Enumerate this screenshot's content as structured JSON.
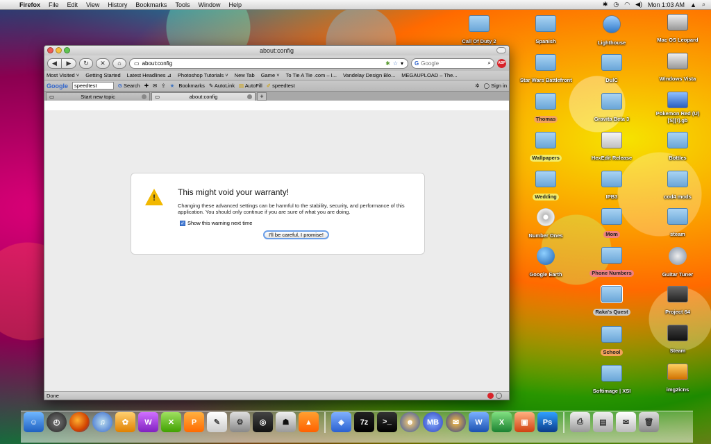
{
  "menubar": {
    "apple": "",
    "items": [
      "Firefox",
      "File",
      "Edit",
      "View",
      "History",
      "Bookmarks",
      "Tools",
      "Window",
      "Help"
    ],
    "clock": "Mon 1:03 AM"
  },
  "window": {
    "title": "about:config",
    "url": "about:config",
    "search_placeholder": "Google",
    "bookmarks": [
      "Most Visited ˅",
      "Getting Started",
      "Latest Headlines ⊿",
      "Photoshop Tutorials ˅",
      "New Tab",
      "Game ˅",
      "To Tie A Tie .com – I...",
      "Vandelay Design Blo...",
      "MEGAUPLOAD – The..."
    ],
    "googlebar": {
      "logo": "Google",
      "query": "speedtest",
      "search_label": "Search",
      "bookmarks_label": "Bookmarks",
      "autolink_label": "AutoLink",
      "autofill_label": "AutoFill",
      "speedtest_label": "speedtest",
      "signin_label": "Sign in"
    },
    "tabs": [
      {
        "label": "Start new topic"
      },
      {
        "label": "about:config"
      }
    ],
    "status": "Done"
  },
  "warning": {
    "title": "This might void your warranty!",
    "body": "Changing these advanced settings can be harmful to the stability, security, and performance of this application. You should only continue if you are sure of what you are doing.",
    "checkbox_label": "Show this warning next time",
    "button_label": "I'll be careful, I promise!"
  },
  "desktop": {
    "col1": [
      "Call Of Duty 2"
    ],
    "col2": [
      "Spanish",
      "Star Wars Battlefront",
      "Thomas",
      "Wallpapers",
      "Wedding",
      "Number Ones",
      "Google Earth"
    ],
    "col3": [
      "Lighthouse",
      "DulC",
      "Gravita Beta 3",
      "HexEdit Release",
      "IPB3",
      "Mom",
      "Phone Numbers",
      "Raka's Quest",
      "School",
      "Softimage | XSI"
    ],
    "col4": [
      "Mac OS Leopard",
      "Windows Vista",
      "Pokemon Red (U) [S][!].gb",
      "Bottles",
      "cod4 mods",
      "steam",
      "Guitar Tuner",
      "Project 64",
      "Steam",
      "img2icns"
    ]
  },
  "dock": {
    "ms_label": "MB",
    "zip_label": "7z",
    "ps_label": "Ps",
    "word_label": "W",
    "excel_label": "X"
  }
}
